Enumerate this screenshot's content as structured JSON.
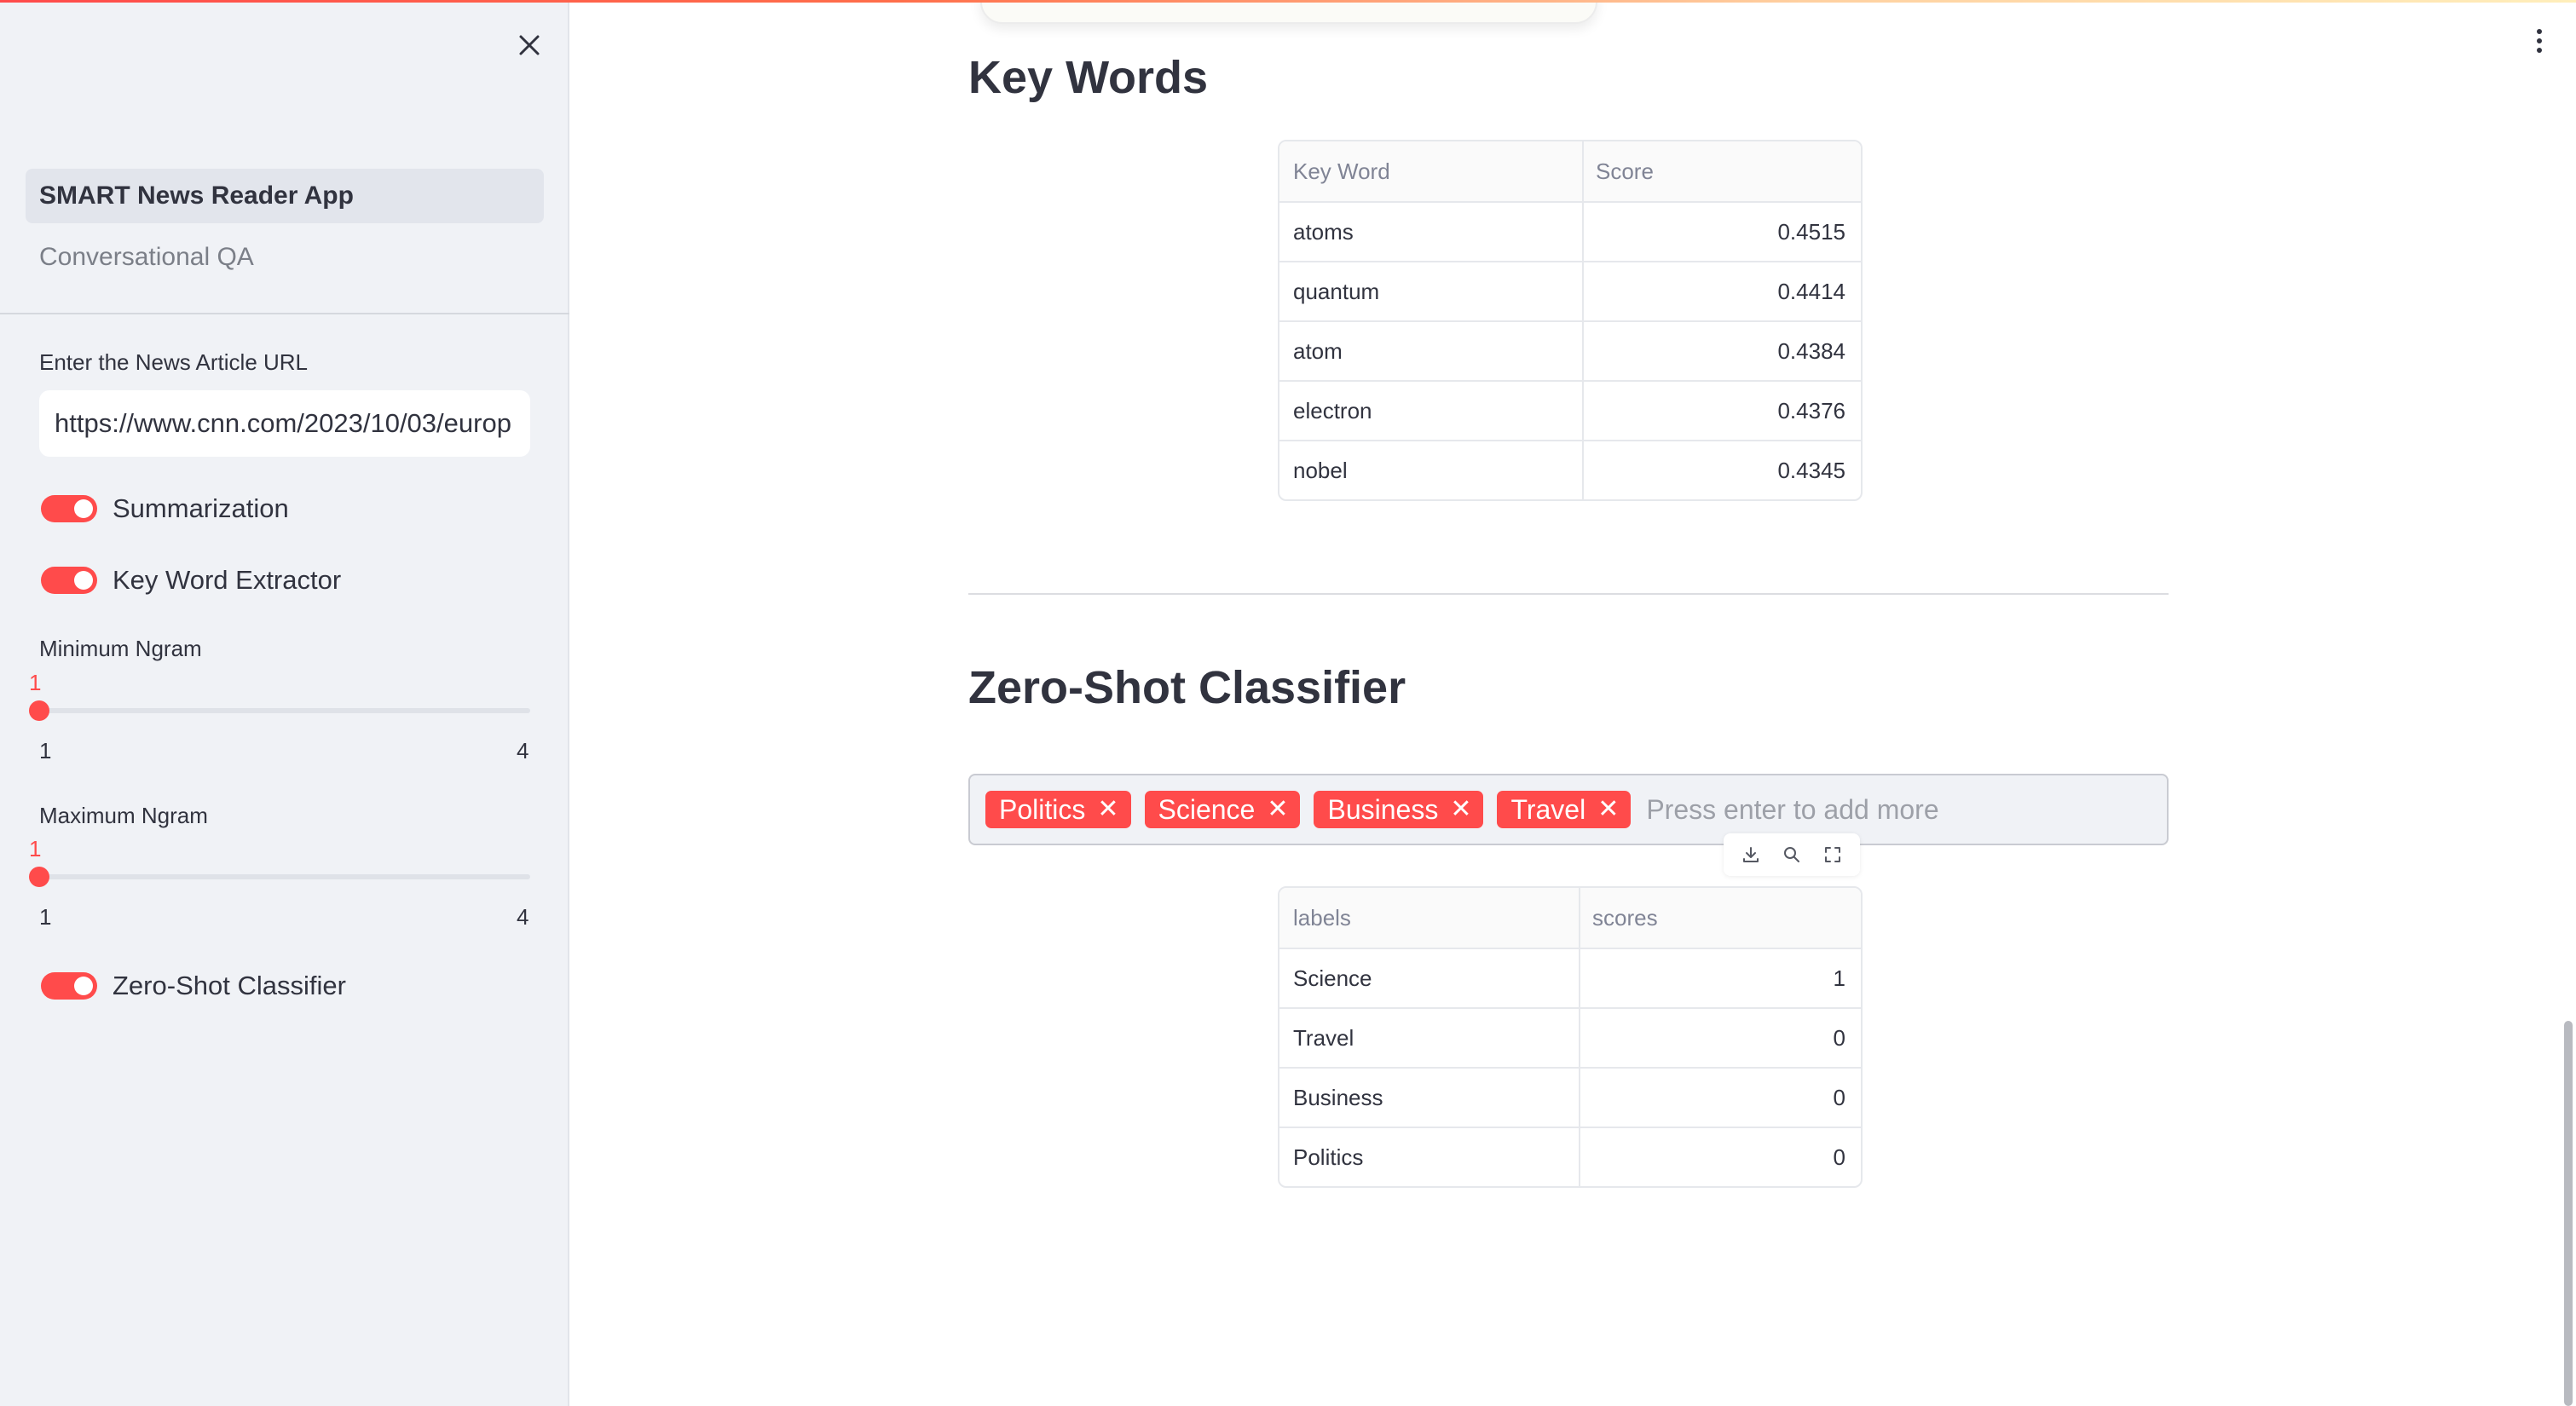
{
  "sidebar": {
    "nav": [
      {
        "label": "SMART News Reader App",
        "active": true
      },
      {
        "label": "Conversational QA",
        "active": false
      }
    ],
    "url_label": "Enter the News Article URL",
    "url_value": "https://www.cnn.com/2023/10/03/europ",
    "toggles": {
      "summarization": "Summarization",
      "keyword": "Key Word Extractor",
      "zeroshot": "Zero-Shot Classifier"
    },
    "min_ngram": {
      "label": "Minimum Ngram",
      "value": "1",
      "min": "1",
      "max": "4"
    },
    "max_ngram": {
      "label": "Maximum Ngram",
      "value": "1",
      "min": "1",
      "max": "4"
    }
  },
  "keywords": {
    "title": "Key Words",
    "columns": [
      "Key Word",
      "Score"
    ],
    "rows": [
      [
        "atoms",
        "0.4515"
      ],
      [
        "quantum",
        "0.4414"
      ],
      [
        "atom",
        "0.4384"
      ],
      [
        "electron",
        "0.4376"
      ],
      [
        "nobel",
        "0.4345"
      ]
    ]
  },
  "zeroshot": {
    "title": "Zero-Shot Classifier",
    "tags": [
      "Politics",
      "Science",
      "Business",
      "Travel"
    ],
    "placeholder": "Press enter to add more",
    "columns": [
      "labels",
      "scores"
    ],
    "rows": [
      [
        "Science",
        "1"
      ],
      [
        "Travel",
        "0"
      ],
      [
        "Business",
        "0"
      ],
      [
        "Politics",
        "0"
      ]
    ]
  },
  "colors": {
    "accent": "#ff4b4b",
    "sidebar_bg": "#f0f2f6",
    "text": "#31333f"
  },
  "icons": {
    "close": "close-icon",
    "menu": "kebab-menu-icon",
    "download": "download-icon",
    "search": "search-icon",
    "fullscreen": "fullscreen-icon",
    "tag_remove": "close-icon"
  }
}
